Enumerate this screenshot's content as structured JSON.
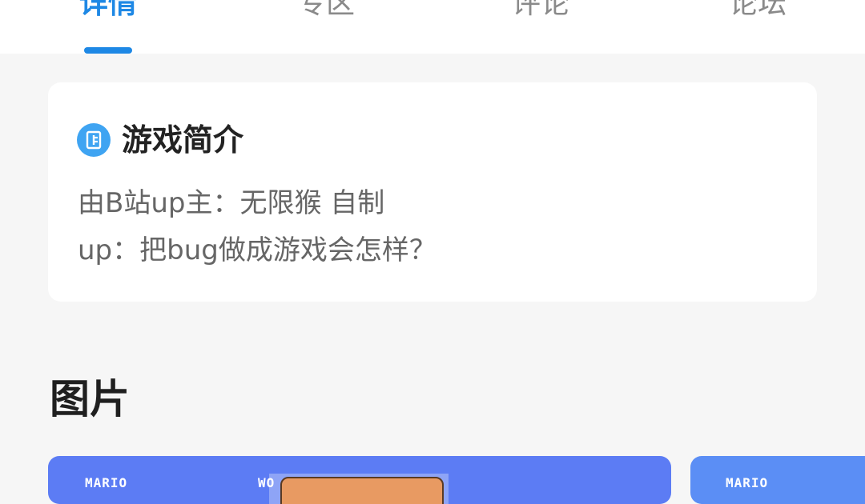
{
  "tabs": [
    {
      "label": "详情",
      "active": true
    },
    {
      "label": "专区",
      "active": false
    },
    {
      "label": "评论",
      "active": false
    },
    {
      "label": "论坛",
      "active": false
    }
  ],
  "intro": {
    "icon": "document-list-icon",
    "title": "游戏简介",
    "lines": [
      "由B站up主：无限猴 自制",
      "up：把bug做成游戏会怎样？"
    ]
  },
  "gallery": {
    "title": "图片",
    "screenshots": [
      {
        "hud_left": "MARIO",
        "hud_mid": "WO"
      },
      {
        "hud_left": "MARIO"
      }
    ]
  },
  "colors": {
    "accent": "#1e88e5",
    "background": "#f6f6f6",
    "card": "#ffffff"
  }
}
